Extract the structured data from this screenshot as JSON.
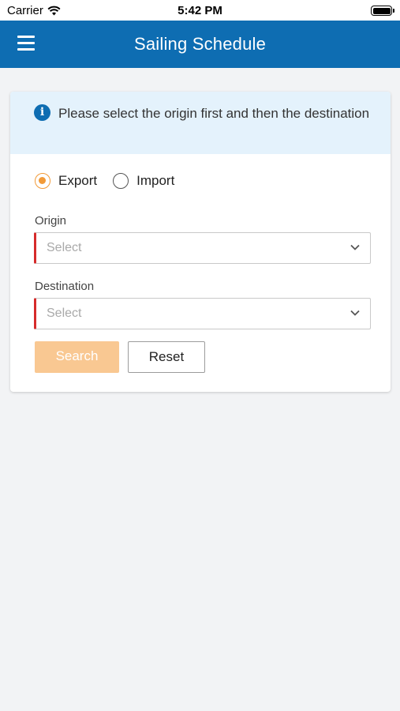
{
  "status_bar": {
    "carrier": "Carrier",
    "time": "5:42 PM",
    "battery_level": 1.0
  },
  "app_bar": {
    "title": "Sailing Schedule",
    "menu_icon": "hamburger-icon"
  },
  "info": {
    "icon": "info-icon",
    "icon_glyph": "i",
    "message": "Please select the origin first and then the destination"
  },
  "direction": {
    "options": [
      {
        "label": "Export",
        "selected": true
      },
      {
        "label": "Import",
        "selected": false
      }
    ]
  },
  "origin": {
    "label": "Origin",
    "placeholder": "Select"
  },
  "destination": {
    "label": "Destination",
    "placeholder": "Select"
  },
  "actions": {
    "search_label": "Search",
    "reset_label": "Reset"
  },
  "colors": {
    "primary": "#0e6db2",
    "accent": "#f29a38",
    "search_disabled": "#f9c892",
    "required_marker": "#d62b2b",
    "info_background": "#e4f2fc"
  }
}
